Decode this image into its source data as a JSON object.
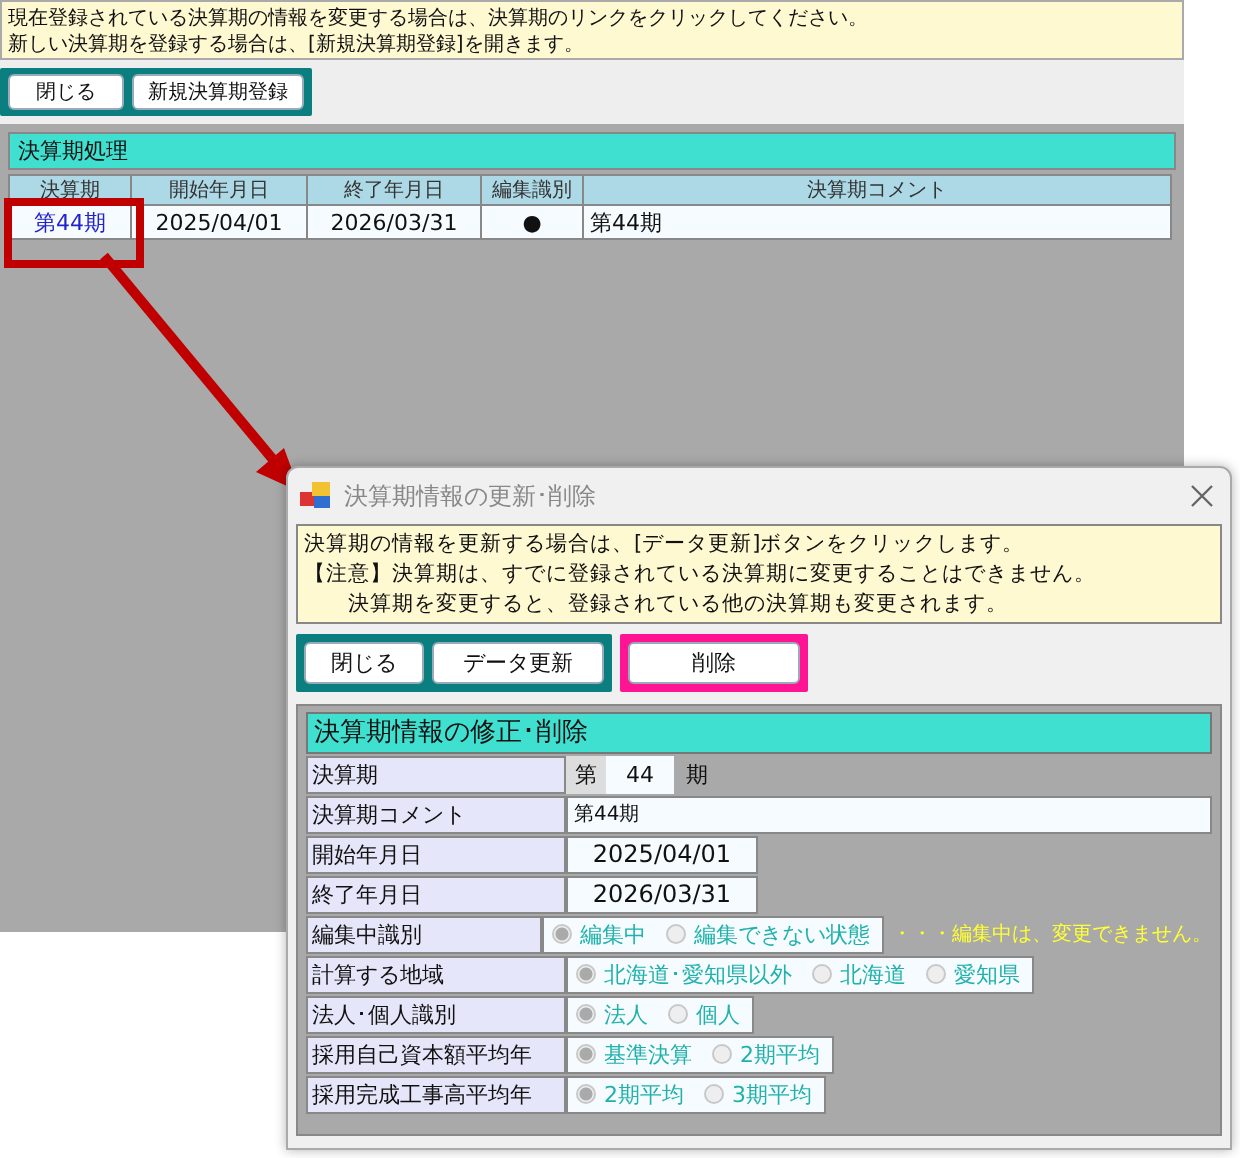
{
  "main": {
    "notice": [
      "現在登録されている決算期の情報を変更する場合は、決算期のリンクをクリックしてください。",
      "新しい決算期を登録する場合は、[新規決算期登録]を開きます。"
    ],
    "buttons": [
      "閉じる",
      "新規決算期登録"
    ],
    "section_title": "決算期処理",
    "table": {
      "columns": [
        "決算期",
        "開始年月日",
        "終了年月日",
        "編集識別",
        "決算期コメント"
      ],
      "rows": [
        {
          "period": "第44期",
          "start": "2025/04/01",
          "end": "2026/03/31",
          "edit_mark": "●",
          "comment": "第44期"
        }
      ]
    }
  },
  "dialog": {
    "title": "決算期情報の更新･削除",
    "notice": [
      "決算期の情報を更新する場合は、[データ更新]ボタンをクリックします。",
      "【注意】決算期は、すでに登録されている決算期に変更することはできません。",
      "決算期を変更すると、登録されている他の決算期も変更されます。"
    ],
    "buttons": [
      {
        "label": "閉じる",
        "kind": "normal"
      },
      {
        "label": "データ更新",
        "kind": "normal"
      },
      {
        "label": "削除",
        "kind": "danger"
      }
    ],
    "section_title": "決算期情報の修正･削除",
    "fields": [
      {
        "kind": "period",
        "label": "決算期",
        "prefix": "第",
        "value": "44",
        "suffix": "期"
      },
      {
        "kind": "text",
        "label": "決算期コメント",
        "value": "第44期"
      },
      {
        "kind": "date",
        "label": "開始年月日",
        "value": "2025/04/01"
      },
      {
        "kind": "date",
        "label": "終了年月日",
        "value": "2026/03/31"
      },
      {
        "kind": "radio",
        "label": "編集中識別",
        "options": [
          {
            "label": "編集中",
            "selected": true
          },
          {
            "label": "編集できない状態",
            "selected": false
          }
        ],
        "note": "・・・編集中は、変更できません。"
      },
      {
        "kind": "radio",
        "label": "計算する地域",
        "options": [
          {
            "label": "北海道･愛知県以外",
            "selected": true
          },
          {
            "label": "北海道",
            "selected": false
          },
          {
            "label": "愛知県",
            "selected": false
          }
        ]
      },
      {
        "kind": "radio",
        "label": "法人･個人識別",
        "options": [
          {
            "label": "法人",
            "selected": true
          },
          {
            "label": "個人",
            "selected": false
          }
        ]
      },
      {
        "kind": "radio",
        "label": "採用自己資本額平均年",
        "options": [
          {
            "label": "基準決算",
            "selected": true
          },
          {
            "label": "2期平均",
            "selected": false
          }
        ]
      },
      {
        "kind": "radio",
        "label": "採用完成工事高平均年",
        "options": [
          {
            "label": "2期平均",
            "selected": true
          },
          {
            "label": "3期平均",
            "selected": false
          }
        ]
      }
    ]
  }
}
